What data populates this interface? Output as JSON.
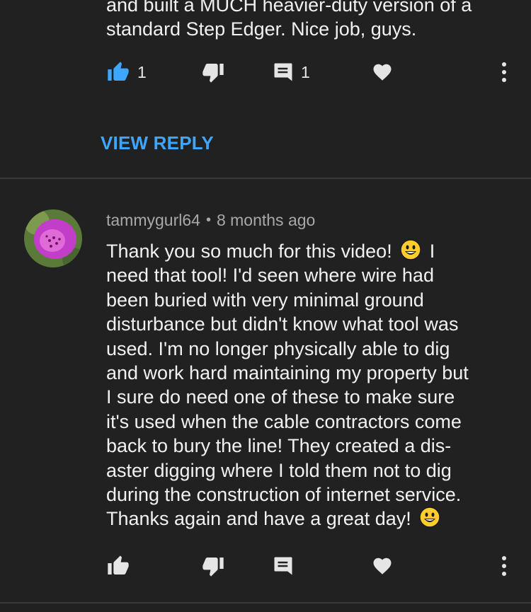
{
  "comments": [
    {
      "text_visible": "and built a MUCH heavier-duty version of a\nstandard Step Edger. Nice job, guys.",
      "likes": "1",
      "replies_count": "1",
      "view_reply_label": "VIEW REPLY"
    },
    {
      "author": "tammygurl64",
      "time": "8 months ago",
      "text_part1": "Thank you so much for this video! ",
      "text_part2": " I\nneed that tool!  I'd seen where wire had\nbeen buried with very minimal ground\ndisturbance but didn't know what tool was\nused.  I'm no longer physically able to dig\nand work hard maintaining my property but\nI sure do need one of these to make sure\nit's used when the cable contractors come\nback to bury the line!  They created a dis-\naster digging where I told them not to dig\nduring the construction of internet service.\nThanks again and have a great day! ",
      "emoji_name": "grinning-face-emoji"
    }
  ],
  "icons": {
    "like": "thumbs-up-icon",
    "dislike": "thumbs-down-icon",
    "reply": "reply-comment-icon",
    "heart": "heart-icon",
    "more": "more-vertical-icon"
  },
  "colors": {
    "background": "#212121",
    "accent": "#3ea6ff",
    "text": "#f1f1f1",
    "meta": "#a8a8a8"
  }
}
